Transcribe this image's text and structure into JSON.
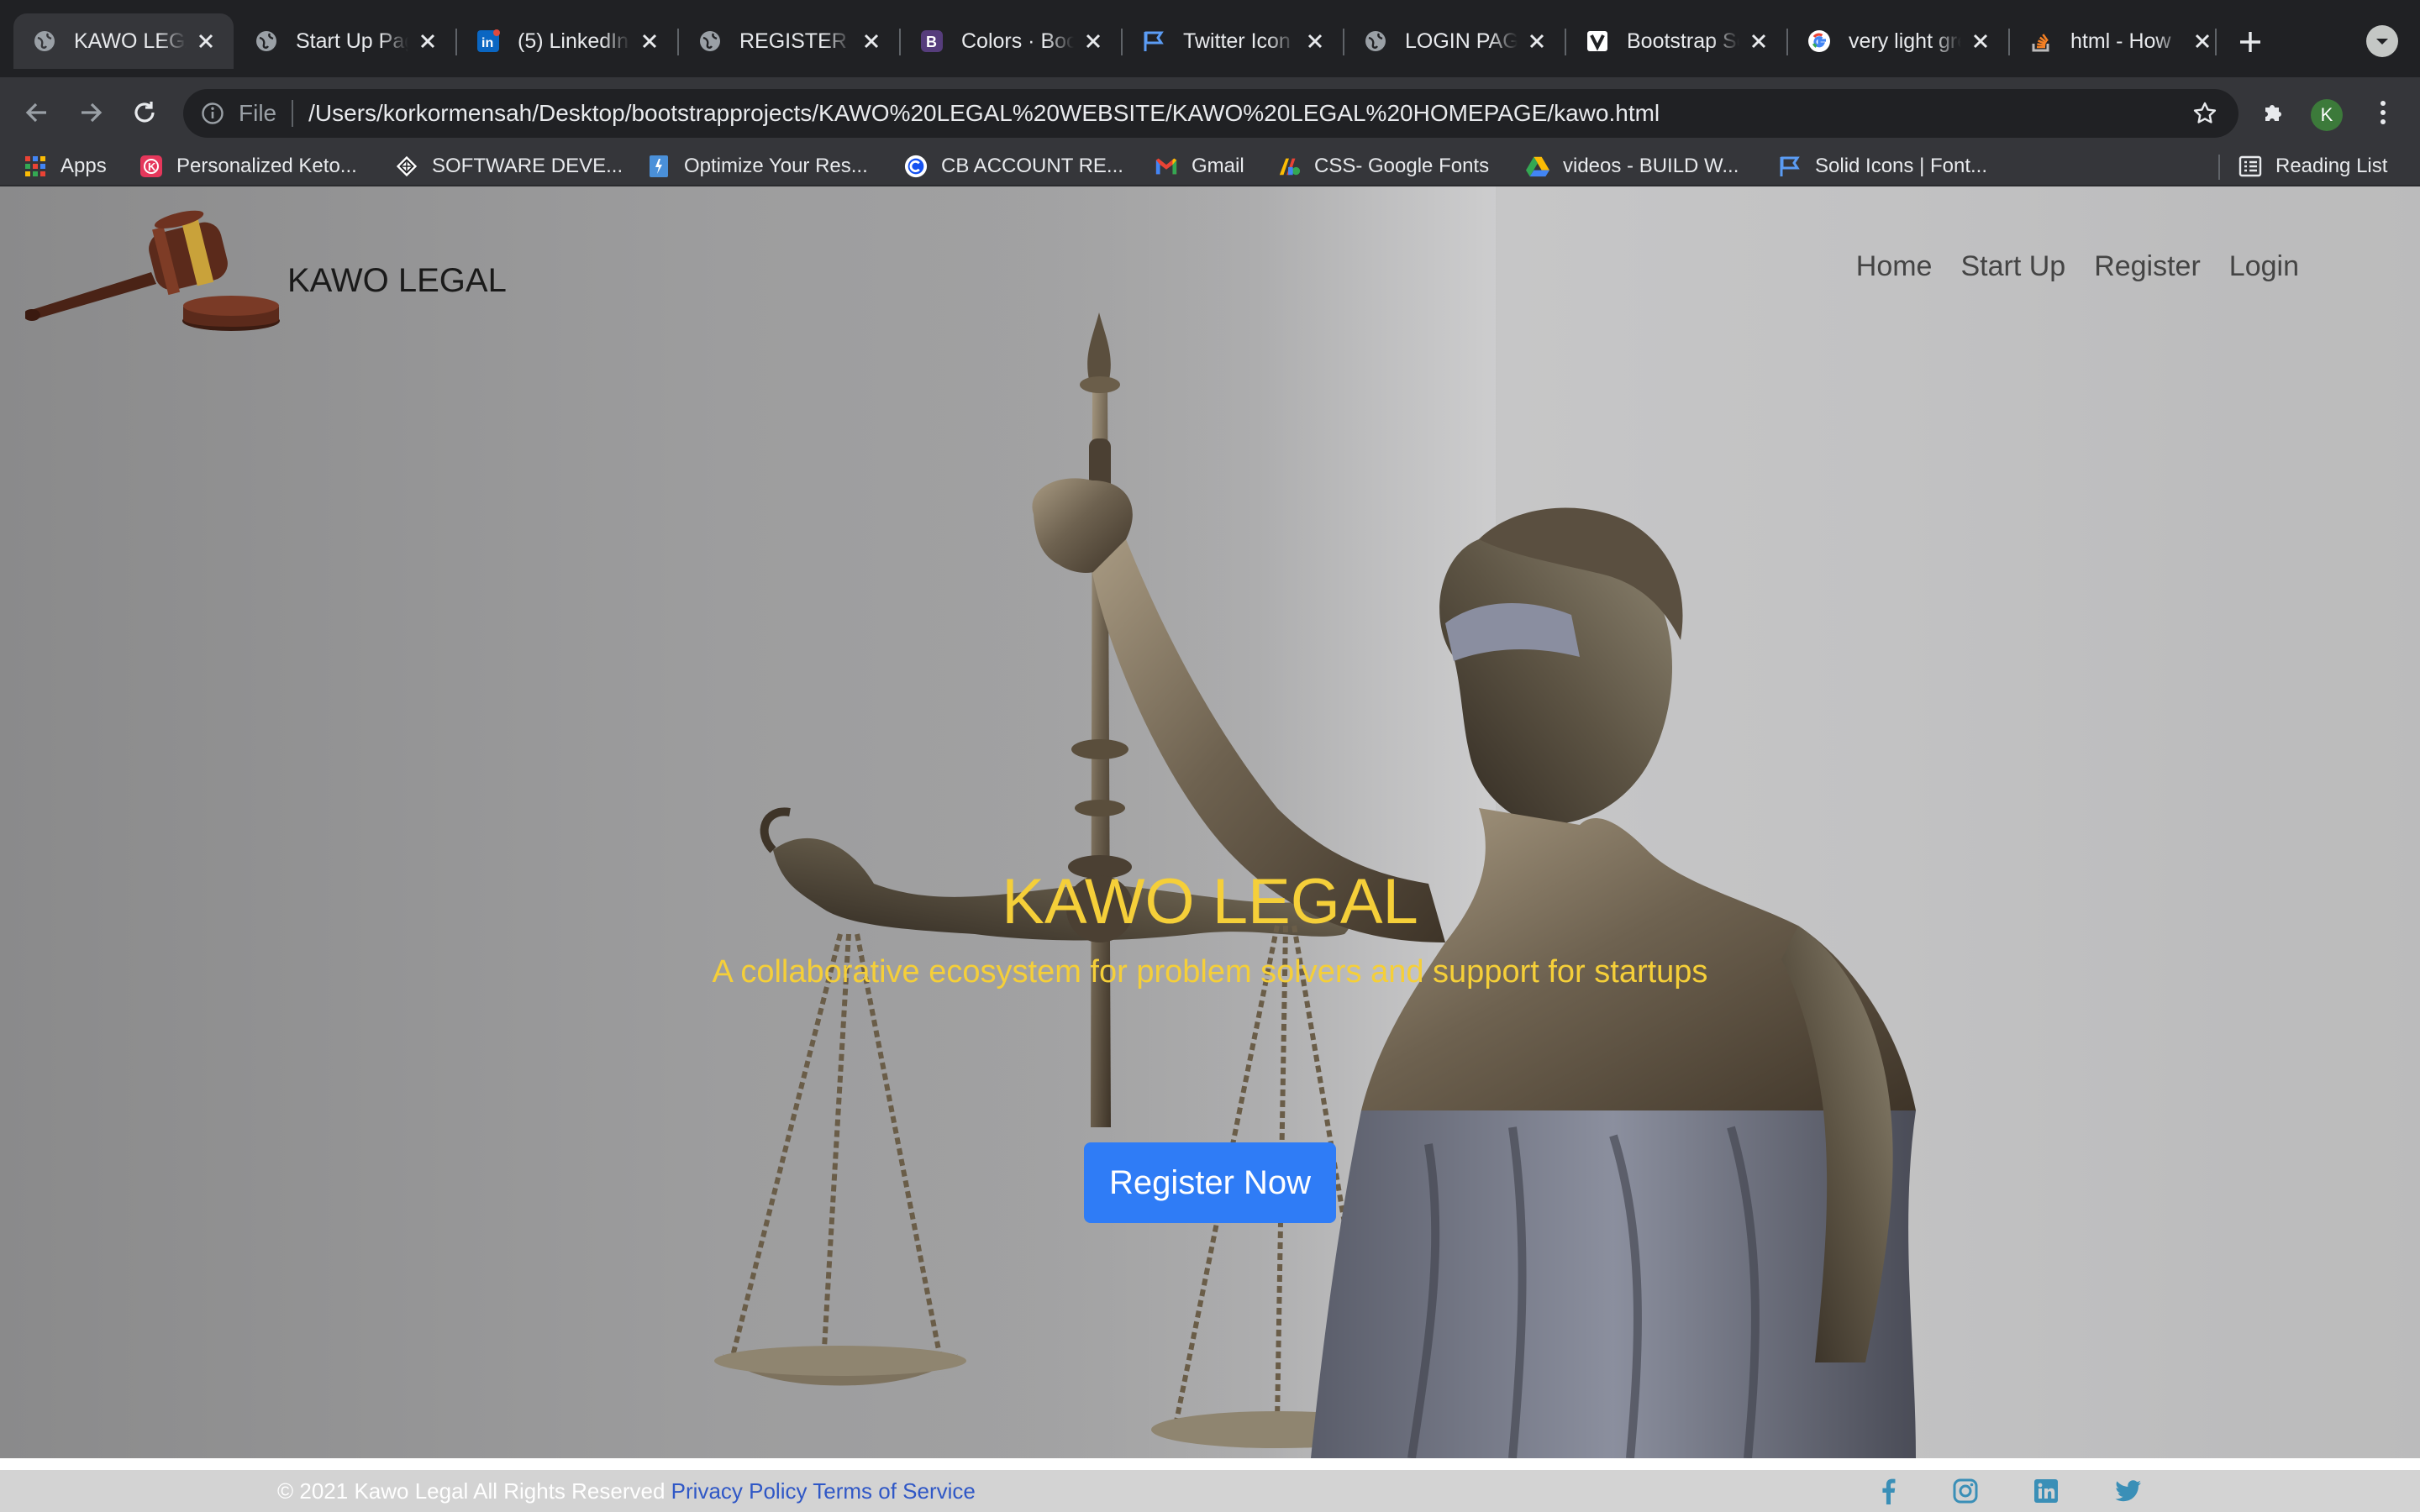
{
  "browser": {
    "tabs": [
      {
        "title": "KAWO LEGAL",
        "icon": "globe-icon",
        "active": true
      },
      {
        "title": "Start Up Page",
        "icon": "globe-icon",
        "active": false
      },
      {
        "title": "(5) LinkedIn",
        "icon": "linkedin-icon",
        "active": false
      },
      {
        "title": "REGISTER PAGE",
        "icon": "globe-icon",
        "active": false
      },
      {
        "title": "Colors · Bootstrap",
        "icon": "bootstrap-icon",
        "active": false
      },
      {
        "title": "Twitter Icon",
        "icon": "flag-icon",
        "active": false
      },
      {
        "title": "LOGIN PAGE",
        "icon": "globe-icon",
        "active": false
      },
      {
        "title": "Bootstrap Social",
        "icon": "shield-icon",
        "active": false
      },
      {
        "title": "very light grey",
        "icon": "google-icon",
        "active": false
      },
      {
        "title": "html - How",
        "icon": "stackoverflow-icon",
        "active": false
      }
    ],
    "address": {
      "scheme": "File",
      "url": "/Users/korkormensah/Desktop/bootstrapprojects/KAWO%20LEGAL%20WEBSITE/KAWO%20LEGAL%20HOMEPAGE/kawo.html"
    },
    "profile_initial": "K",
    "bookmarks": [
      {
        "label": "Apps",
        "icon": "apps-grid-icon"
      },
      {
        "label": "Personalized Keto...",
        "icon": "keto-icon"
      },
      {
        "label": "SOFTWARE DEVE...",
        "icon": "software-icon"
      },
      {
        "label": "Optimize Your Res...",
        "icon": "document-icon"
      },
      {
        "label": "CB ACCOUNT RE...",
        "icon": "cb-icon"
      },
      {
        "label": "Gmail",
        "icon": "gmail-icon"
      },
      {
        "label": "CSS- Google Fonts",
        "icon": "google-fonts-icon"
      },
      {
        "label": "videos - BUILD W...",
        "icon": "drive-icon"
      },
      {
        "label": "Solid Icons | Font...",
        "icon": "flag-icon"
      }
    ],
    "reading_list": "Reading List"
  },
  "site": {
    "brand": "KAWO LEGAL",
    "nav": [
      "Home",
      "Start Up",
      "Register",
      "Login"
    ],
    "hero_title": "KAWO LEGAL",
    "hero_subtitle": "A collaborative ecosystem for problem solvers and support for startups",
    "cta_label": "Register Now",
    "footer": {
      "copyright": "© 2021 Kawo Legal All Rights Reserved",
      "privacy": "Privacy Policy",
      "terms": "Terms of Service"
    },
    "social_icons": [
      "facebook-icon",
      "instagram-icon",
      "linkedin-icon",
      "twitter-icon"
    ]
  },
  "colors": {
    "hero_text": "#f5cf39",
    "cta_background": "#2f7cf6",
    "footer_link": "#2f57c6",
    "social_icon": "#3a8fb7"
  }
}
